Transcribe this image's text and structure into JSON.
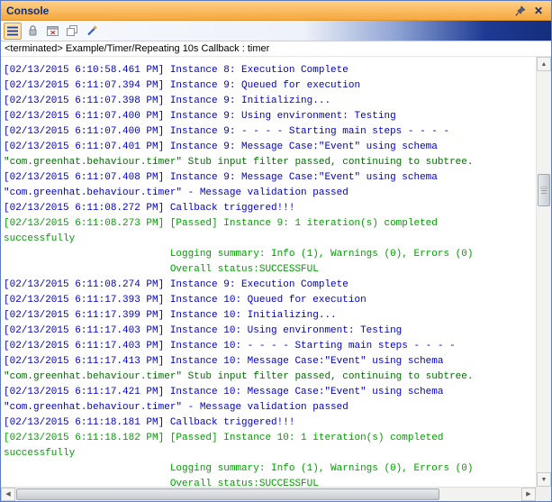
{
  "panel": {
    "title": "Console"
  },
  "titlebar": {
    "pin_icon": "pin-icon",
    "close_icon": "close-icon"
  },
  "toolbar": {
    "icons": [
      "menu-icon",
      "lock-icon",
      "console-window-icon",
      "copy-console-icon",
      "clear-console-icon"
    ]
  },
  "status_line": "<terminated> Example/Timer/Repeating 10s Callback : timer",
  "colors": {
    "stdout_blue": "#0000c4",
    "pass_green": "#00a000",
    "stub_green": "#006e00",
    "titlebar_top": "#fdd089",
    "titlebar_bottom": "#f6a83e"
  },
  "console": {
    "lines": [
      {
        "text": "                            Overall status:SUCCESSFUL",
        "color": "green"
      },
      {
        "text": "[02/13/2015 6:10:58.461 PM] Instance 8: Execution Complete",
        "color": "blue"
      },
      {
        "text": "[02/13/2015 6:11:07.394 PM] Instance 9: Queued for execution",
        "color": "blue"
      },
      {
        "text": "[02/13/2015 6:11:07.398 PM] Instance 9: Initializing...",
        "color": "blue"
      },
      {
        "text": "[02/13/2015 6:11:07.400 PM] Instance 9: Using environment: Testing",
        "color": "blue"
      },
      {
        "text": "[02/13/2015 6:11:07.400 PM] Instance 9: - - - - Starting main steps - - - -",
        "color": "blue"
      },
      {
        "text": "[02/13/2015 6:11:07.401 PM] Instance 9: Message Case:\"Event\" using schema",
        "color": "blue"
      },
      {
        "text": "\"com.greenhat.behaviour.timer\" Stub input filter passed, continuing to subtree.",
        "color": "dkgreen"
      },
      {
        "text": "[02/13/2015 6:11:07.408 PM] Instance 9: Message Case:\"Event\" using schema",
        "color": "blue"
      },
      {
        "text": "\"com.greenhat.behaviour.timer\" - Message validation passed",
        "color": "blue"
      },
      {
        "text": "[02/13/2015 6:11:08.272 PM] Callback triggered!!!",
        "color": "blue"
      },
      {
        "text": "[02/13/2015 6:11:08.273 PM] [Passed] Instance 9: 1 iteration(s) completed",
        "color": "green"
      },
      {
        "text": "successfully",
        "color": "green"
      },
      {
        "text": "                            Logging summary: Info (1), Warnings (0), Errors (0)",
        "color": "green"
      },
      {
        "text": "                            Overall status:SUCCESSFUL",
        "color": "green"
      },
      {
        "text": "[02/13/2015 6:11:08.274 PM] Instance 9: Execution Complete",
        "color": "blue"
      },
      {
        "text": "[02/13/2015 6:11:17.393 PM] Instance 10: Queued for execution",
        "color": "blue"
      },
      {
        "text": "[02/13/2015 6:11:17.399 PM] Instance 10: Initializing...",
        "color": "blue"
      },
      {
        "text": "[02/13/2015 6:11:17.403 PM] Instance 10: Using environment: Testing",
        "color": "blue"
      },
      {
        "text": "[02/13/2015 6:11:17.403 PM] Instance 10: - - - - Starting main steps - - - -",
        "color": "blue"
      },
      {
        "text": "[02/13/2015 6:11:17.413 PM] Instance 10: Message Case:\"Event\" using schema",
        "color": "blue"
      },
      {
        "text": "\"com.greenhat.behaviour.timer\" Stub input filter passed, continuing to subtree.",
        "color": "dkgreen"
      },
      {
        "text": "[02/13/2015 6:11:17.421 PM] Instance 10: Message Case:\"Event\" using schema",
        "color": "blue"
      },
      {
        "text": "\"com.greenhat.behaviour.timer\" - Message validation passed",
        "color": "blue"
      },
      {
        "text": "[02/13/2015 6:11:18.181 PM] Callback triggered!!!",
        "color": "blue"
      },
      {
        "text": "[02/13/2015 6:11:18.182 PM] [Passed] Instance 10: 1 iteration(s) completed",
        "color": "green"
      },
      {
        "text": "successfully",
        "color": "green"
      },
      {
        "text": "                            Logging summary: Info (1), Warnings (0), Errors (0)",
        "color": "green"
      },
      {
        "text": "                            Overall status:SUCCESSFUL",
        "color": "green"
      }
    ]
  }
}
